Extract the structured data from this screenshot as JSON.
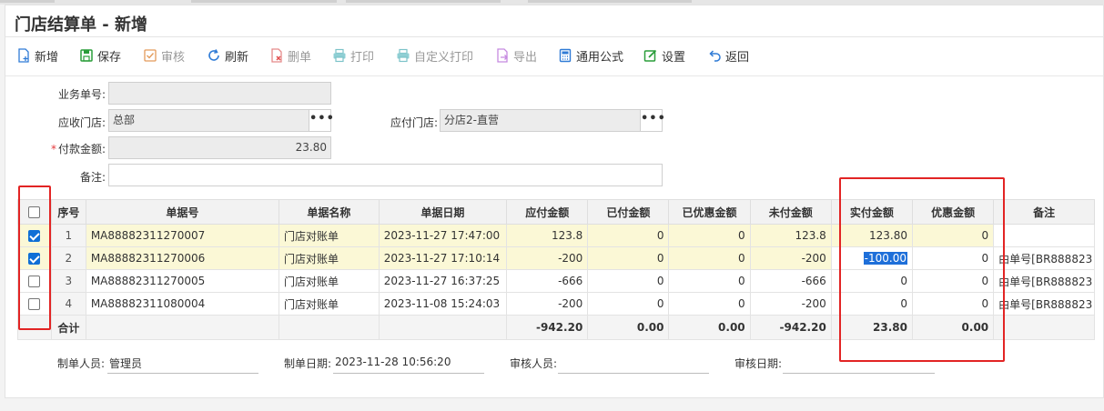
{
  "title": "门店结算单 - 新增",
  "toolbar": {
    "new": "新增",
    "save": "保存",
    "audit": "审核",
    "refresh": "刷新",
    "delete": "删单",
    "print": "打印",
    "custom_print": "自定义打印",
    "export": "导出",
    "formula": "通用公式",
    "settings": "设置",
    "back": "返回"
  },
  "form": {
    "biz_no_label": "业务单号:",
    "biz_no_value": "",
    "recv_store_label": "应收门店:",
    "recv_store_value": "总部",
    "pay_store_label": "应付门店:",
    "pay_store_value": "分店2-直营",
    "amount_required": "*",
    "amount_label": "付款金额:",
    "amount_value": "23.80",
    "remark_label": "备注:",
    "remark_value": "",
    "dots": "•••"
  },
  "grid": {
    "headers": [
      "序号",
      "单据号",
      "单据名称",
      "单据日期",
      "应付金额",
      "已付金额",
      "已优惠金额",
      "未付金额",
      "实付金额",
      "优惠金额",
      "备注"
    ],
    "rows": [
      {
        "checked": true,
        "seq": "1",
        "doc_no": "MA88882311270007",
        "doc_name": "门店对账单",
        "doc_date": "2023-11-27 17:47:00",
        "payable": "123.8",
        "paid": "0",
        "discounted": "0",
        "unpaid": "123.8",
        "actual": "123.80",
        "discount": "0",
        "remark": ""
      },
      {
        "checked": true,
        "seq": "2",
        "doc_no": "MA88882311270006",
        "doc_name": "门店对账单",
        "doc_date": "2023-11-27 17:10:14",
        "payable": "-200",
        "paid": "0",
        "discounted": "0",
        "unpaid": "-200",
        "actual": "-100.00",
        "discount": "0",
        "remark": "由单号[BR888823"
      },
      {
        "checked": false,
        "seq": "3",
        "doc_no": "MA88882311270005",
        "doc_name": "门店对账单",
        "doc_date": "2023-11-27 16:37:25",
        "payable": "-666",
        "paid": "0",
        "discounted": "0",
        "unpaid": "-666",
        "actual": "0",
        "discount": "0",
        "remark": "由单号[BR888823"
      },
      {
        "checked": false,
        "seq": "4",
        "doc_no": "MA88882311080004",
        "doc_name": "门店对账单",
        "doc_date": "2023-11-08 15:24:03",
        "payable": "-200",
        "paid": "0",
        "discounted": "0",
        "unpaid": "-200",
        "actual": "0",
        "discount": "0",
        "remark": "由单号[BR888823"
      }
    ],
    "total": {
      "label": "合计",
      "payable": "-942.20",
      "paid": "0.00",
      "discounted": "0.00",
      "unpaid": "-942.20",
      "actual": "23.80",
      "discount": "0.00"
    }
  },
  "footer": {
    "maker_label": "制单人员:",
    "maker_value": "管理员",
    "make_date_label": "制单日期:",
    "make_date_value": "2023-11-28 10:56:20",
    "auditor_label": "审核人员:",
    "auditor_value": "",
    "audit_date_label": "审核日期:",
    "audit_date_value": ""
  },
  "colors": {
    "accent": "#1e6fd9",
    "highlight_box": "#e22424",
    "selected_row": "#fbf8d6"
  }
}
